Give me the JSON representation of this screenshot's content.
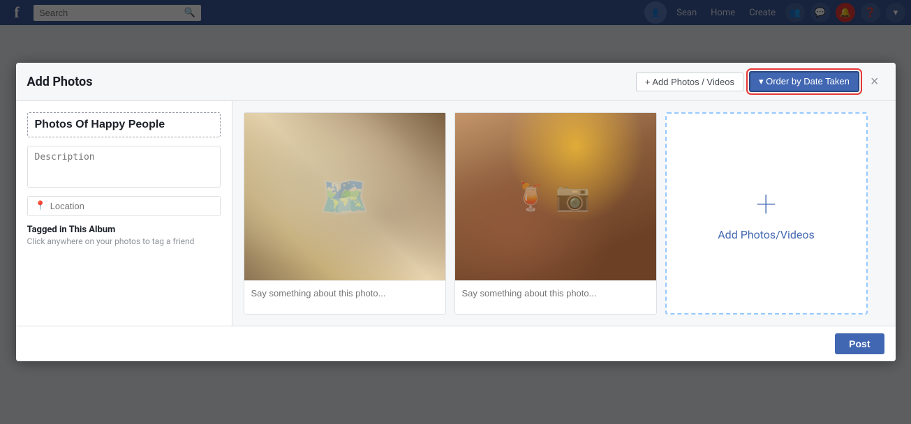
{
  "topbar": {
    "search_placeholder": "Search",
    "nav_items": [
      "Sean",
      "Home",
      "Create"
    ],
    "logo_text": "f"
  },
  "modal": {
    "title": "Add Photos",
    "add_photos_button": "+ Add Photos / Videos",
    "order_button": "▾ Order by Date Taken",
    "close_button": "×",
    "album": {
      "title": "Photos Of Happy People",
      "description_placeholder": "Description",
      "location_placeholder": "Location",
      "tagged_title": "Tagged in This Album",
      "tagged_hint": "Click anywhere on your photos to tag a friend"
    },
    "photos": [
      {
        "id": "photo-1",
        "caption_placeholder": "Say something about this photo...",
        "type": "travel"
      },
      {
        "id": "photo-2",
        "caption_placeholder": "Say something about this photo...",
        "type": "drinks"
      }
    ],
    "add_photos_card": {
      "plus": "+",
      "label": "Add Photos/Videos"
    },
    "footer": {
      "post_button": "Post"
    }
  }
}
